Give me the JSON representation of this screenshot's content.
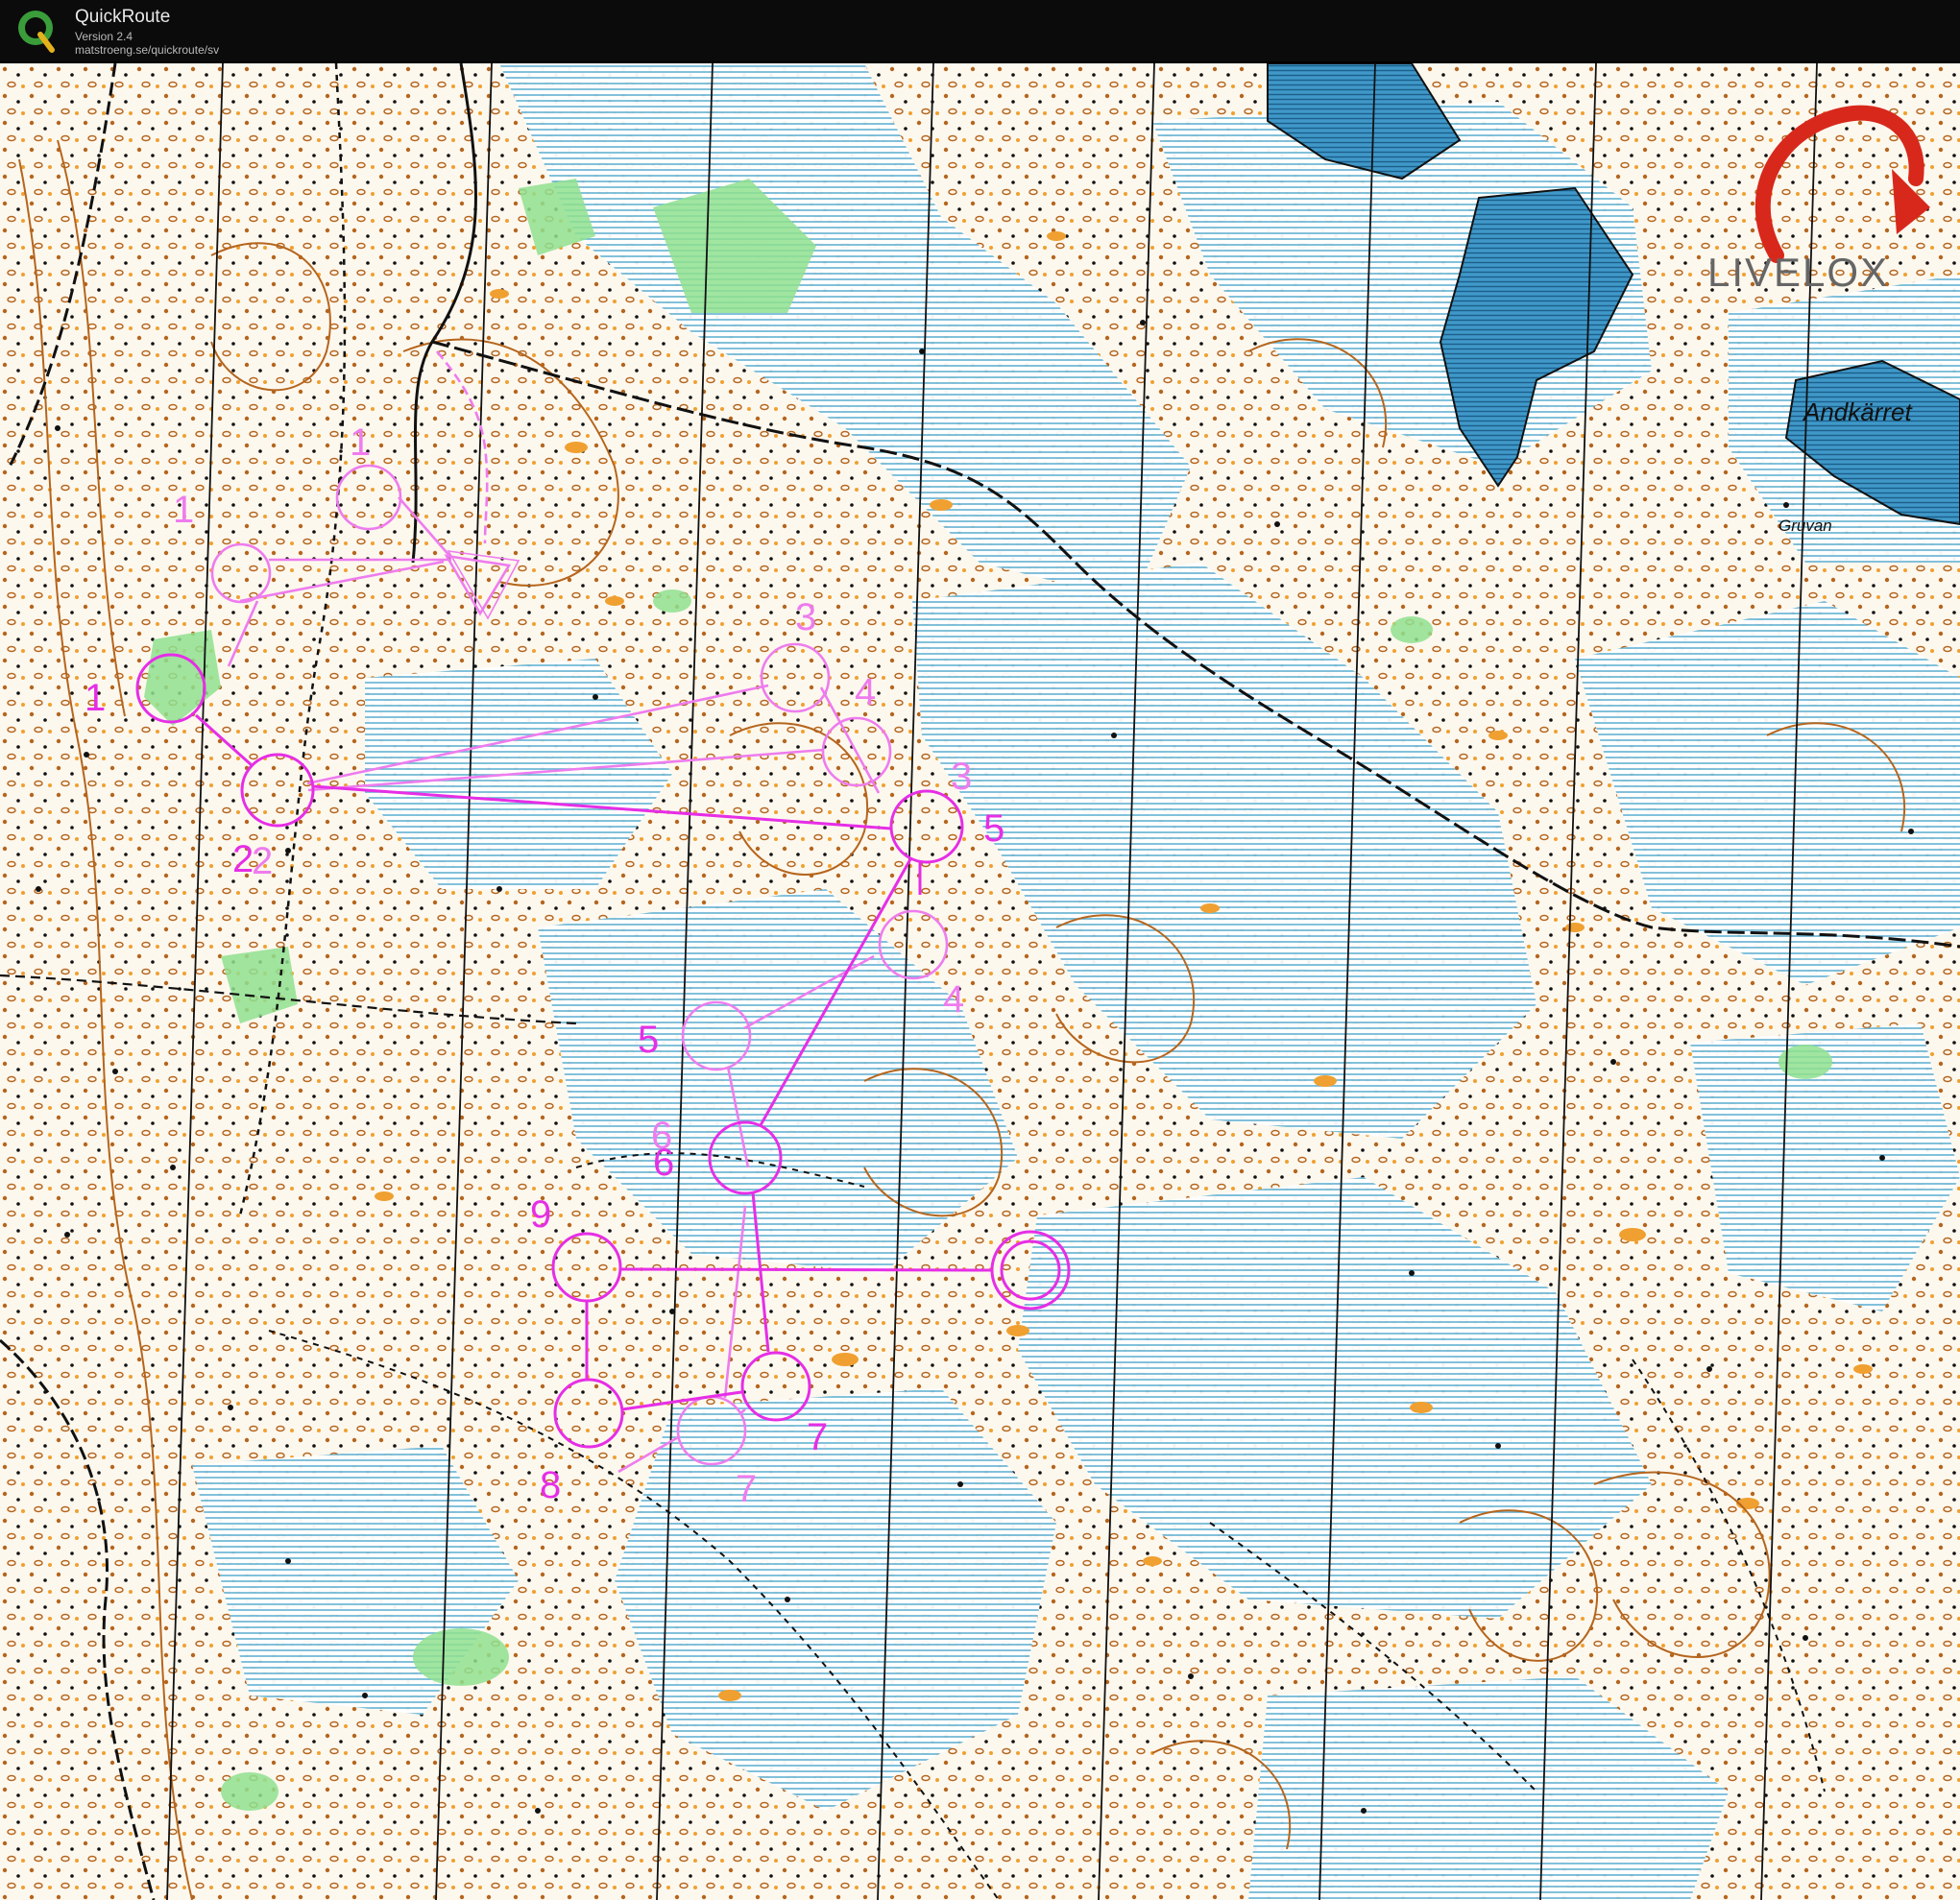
{
  "app": {
    "title": "QuickRoute",
    "version": "Version 2.4",
    "url": "matstroeng.se/quickroute/sv",
    "logo_letter": "Q"
  },
  "watermark": {
    "text": "LIVELOX",
    "icon": "livelox-arrow-icon"
  },
  "place_names": {
    "andkarret": "Andkärret",
    "gruvan": "Gruvan"
  },
  "controls": {
    "c1a": "1",
    "c1b": "1",
    "c1c": "1",
    "c2a": "2",
    "c2b": "2",
    "c3a": "3",
    "c3b": "3",
    "c4a": "4",
    "c4b": "4",
    "c5a": "5",
    "c5b": "5",
    "c6a": "6",
    "c6b": "6",
    "c7a": "7",
    "c7b": "7",
    "c8": "8",
    "c9": "9"
  },
  "colors": {
    "course": "#e62ee6",
    "course_faded": "#ee7cee",
    "water": "#46a9c9",
    "rock": "#f0a030",
    "contour": "#b5651d",
    "vegetation": "#7ad97a"
  }
}
